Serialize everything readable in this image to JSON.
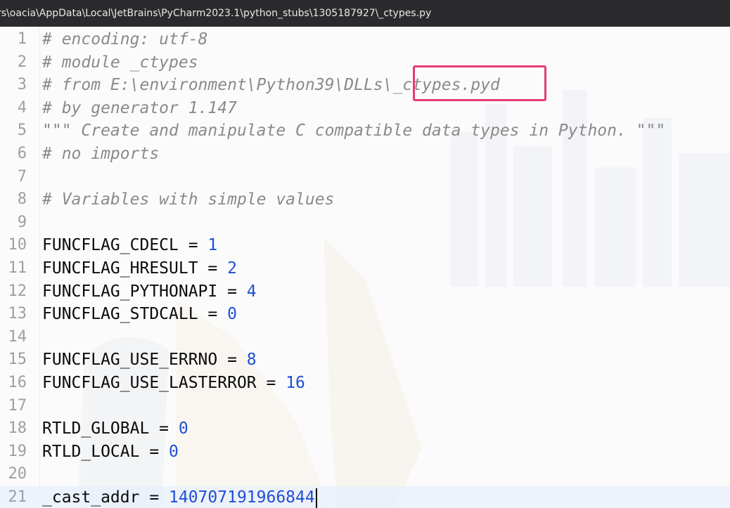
{
  "title_bar": {
    "path": "rs\\oacia\\AppData\\Local\\JetBrains\\PyCharm2023.1\\python_stubs\\1305187927\\_ctypes.py"
  },
  "colors": {
    "highlight_box": "#e83a72",
    "number_literal": "#1f4fd6",
    "comment": "#8a8a8a"
  },
  "editor": {
    "current_line": 21,
    "lines": [
      {
        "num": "1",
        "comment": "# encoding: utf-8"
      },
      {
        "num": "2",
        "comment": "# module _ctypes"
      },
      {
        "num": "3",
        "comment": "# from E:\\environment\\Python39\\DLLs\\_ctypes.pyd"
      },
      {
        "num": "4",
        "comment": "# by generator 1.147"
      },
      {
        "num": "5",
        "comment": "\"\"\" Create and manipulate C compatible data types in Python. \"\"\""
      },
      {
        "num": "6",
        "comment": "# no imports"
      },
      {
        "num": "7"
      },
      {
        "num": "8",
        "comment": "# Variables with simple values"
      },
      {
        "num": "9"
      },
      {
        "num": "10",
        "code": "FUNCFLAG_CDECL = ",
        "value": "1"
      },
      {
        "num": "11",
        "code": "FUNCFLAG_HRESULT = ",
        "value": "2"
      },
      {
        "num": "12",
        "code": "FUNCFLAG_PYTHONAPI = ",
        "value": "4"
      },
      {
        "num": "13",
        "code": "FUNCFLAG_STDCALL = ",
        "value": "0"
      },
      {
        "num": "14"
      },
      {
        "num": "15",
        "code": "FUNCFLAG_USE_ERRNO = ",
        "value": "8"
      },
      {
        "num": "16",
        "code": "FUNCFLAG_USE_LASTERROR = ",
        "value": "16"
      },
      {
        "num": "17"
      },
      {
        "num": "18",
        "code": "RTLD_GLOBAL = ",
        "value": "0"
      },
      {
        "num": "19",
        "code": "RTLD_LOCAL = ",
        "value": "0"
      },
      {
        "num": "20"
      },
      {
        "num": "21",
        "code": "_cast_addr = ",
        "value": "140707191966844"
      }
    ]
  }
}
